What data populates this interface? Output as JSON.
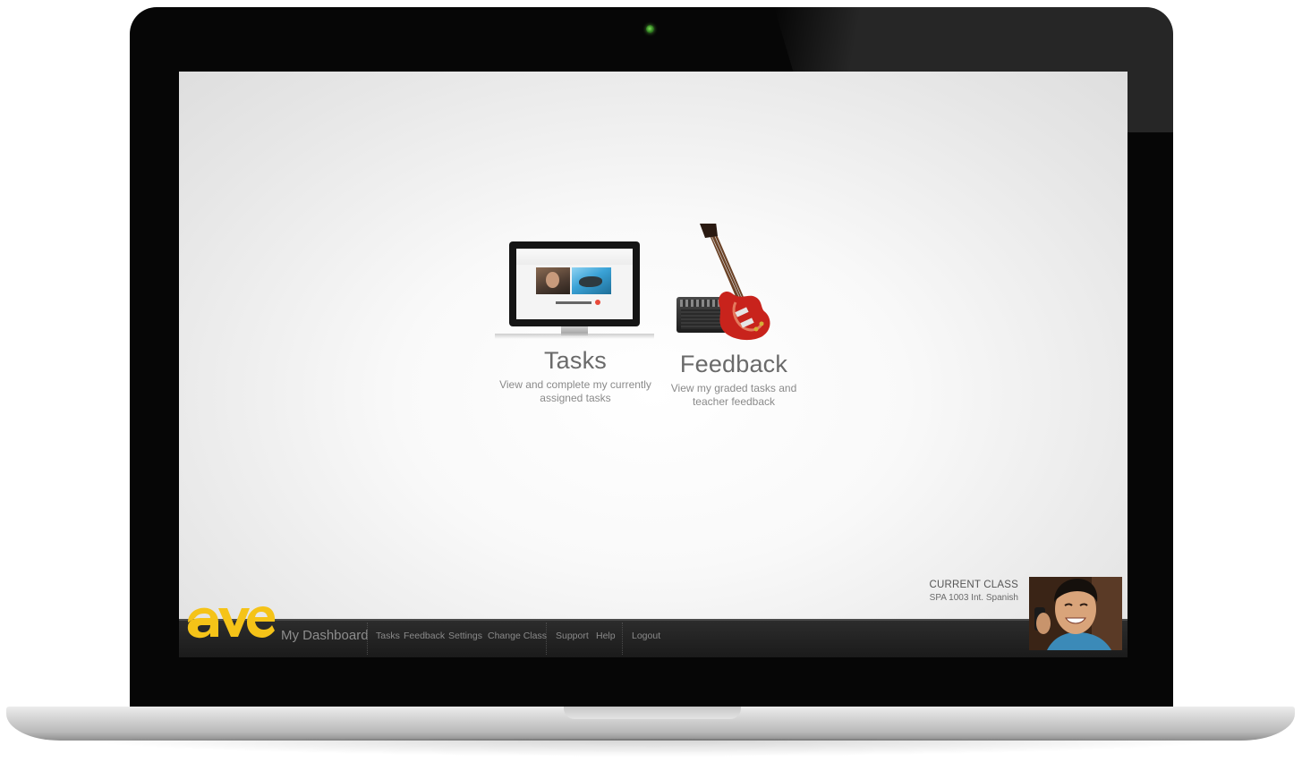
{
  "app": {
    "logo_text": "ave",
    "dashboard_label": "My Dashboard"
  },
  "tiles": [
    {
      "title": "Tasks",
      "description": "View and complete my currently assigned tasks",
      "icon": "monitor-icon"
    },
    {
      "title": "Feedback",
      "description": "View my graded tasks and teacher feedback",
      "icon": "guitar-icon"
    }
  ],
  "nav": {
    "tasks": "Tasks",
    "feedback": "Feedback",
    "settings": "Settings",
    "change_class": "Change Class",
    "support": "Support",
    "help": "Help",
    "logout": "Logout"
  },
  "current_class": {
    "title": "CURRENT CLASS",
    "name": "SPA 1003 Int. Spanish"
  },
  "colors": {
    "brand": "#f5c318",
    "taskbar": "#1f1f1f",
    "screen_bg": "#f4f4f4"
  }
}
